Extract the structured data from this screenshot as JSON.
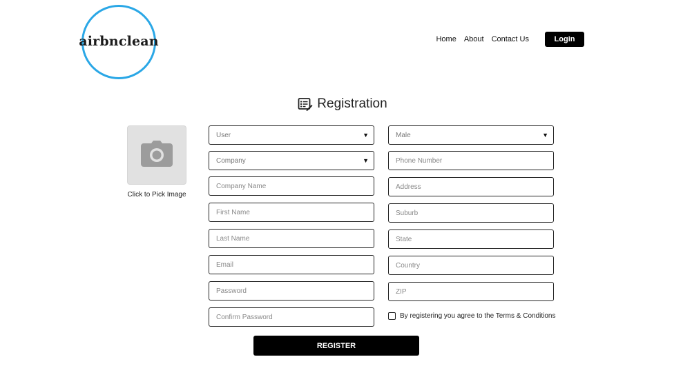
{
  "brand": {
    "logo_text": "airbnclean",
    "accent_color": "#2aa7e6"
  },
  "nav": {
    "items": [
      {
        "label": "Home"
      },
      {
        "label": "About"
      },
      {
        "label": "Contact Us"
      }
    ],
    "login_label": "Login"
  },
  "page": {
    "title": "Registration",
    "title_icon": "list-edit-icon"
  },
  "image_picker": {
    "label": "Click to Pick Image",
    "icon": "camera-icon"
  },
  "form": {
    "left": {
      "user_type": {
        "value": "User"
      },
      "company_select": {
        "value": "Company"
      },
      "company_name": {
        "placeholder": "Company Name"
      },
      "first_name": {
        "placeholder": "First Name"
      },
      "last_name": {
        "placeholder": "Last Name"
      },
      "email": {
        "placeholder": "Email"
      },
      "password": {
        "placeholder": "Password"
      },
      "confirm_password": {
        "placeholder": "Confirm Password"
      }
    },
    "right": {
      "gender": {
        "value": "Male"
      },
      "phone": {
        "placeholder": "Phone Number"
      },
      "address": {
        "placeholder": "Address"
      },
      "suburb": {
        "placeholder": "Suburb"
      },
      "state": {
        "placeholder": "State"
      },
      "country": {
        "placeholder": "Country"
      },
      "zip": {
        "placeholder": "ZIP"
      }
    },
    "terms_label": "By registering you agree to the Terms & Conditions",
    "terms_checked": false,
    "register_label": "REGISTER"
  }
}
